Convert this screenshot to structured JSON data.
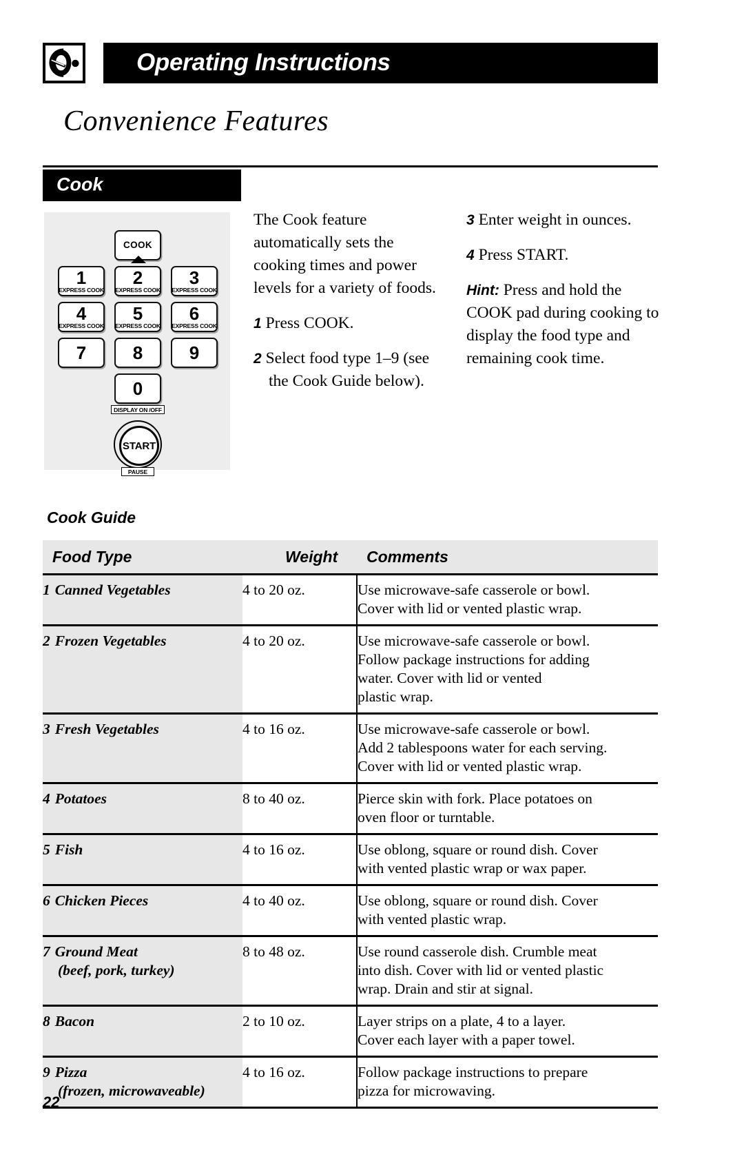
{
  "header": {
    "title": "Operating Instructions",
    "icon": "microwave-door-icon"
  },
  "chapter_title": "Convenience Features",
  "section": {
    "label": "Cook"
  },
  "control_panel": {
    "cook_key": "COOK",
    "express_cook_sub": "EXPRESS COOK",
    "keys": [
      {
        "num": "1",
        "sub": "EXPRESS COOK"
      },
      {
        "num": "2",
        "sub": "EXPRESS COOK"
      },
      {
        "num": "3",
        "sub": "EXPRESS COOK"
      },
      {
        "num": "4",
        "sub": "EXPRESS COOK"
      },
      {
        "num": "5",
        "sub": "EXPRESS COOK"
      },
      {
        "num": "6",
        "sub": "EXPRESS COOK"
      },
      {
        "num": "7",
        "sub": ""
      },
      {
        "num": "8",
        "sub": ""
      },
      {
        "num": "9",
        "sub": ""
      },
      {
        "num": "0",
        "sub": ""
      }
    ],
    "display_tag": "DISPLAY ON /OFF",
    "start_label": "START",
    "pause_label": "PAUSE"
  },
  "instructions": {
    "intro": "The Cook feature automatically sets the cooking times and power levels for a variety of foods.",
    "steps": [
      {
        "num": "1",
        "text": "Press COOK."
      },
      {
        "num": "2",
        "text": "Select food type 1–9 (see the Cook Guide below)."
      },
      {
        "num": "3",
        "text": "Enter weight in ounces."
      },
      {
        "num": "4",
        "text": "Press START."
      }
    ],
    "hint_label": "Hint:",
    "hint_text": "Press and hold the COOK pad during cooking to display the food type and remaining cook time."
  },
  "guide": {
    "title": "Cook Guide",
    "columns": [
      "Food Type",
      "Weight",
      "Comments"
    ],
    "rows": [
      {
        "num": "1",
        "food": "Canned Vegetables",
        "food_sub": "",
        "weight": "4 to 20 oz.",
        "comments": [
          "Use microwave-safe casserole or bowl.",
          "Cover with lid or vented plastic wrap."
        ]
      },
      {
        "num": "2",
        "food": "Frozen Vegetables",
        "food_sub": "",
        "weight": "4 to 20 oz.",
        "comments": [
          "Use microwave-safe casserole or bowl.",
          "Follow package instructions for adding",
          "water. Cover with lid or vented",
          "plastic wrap."
        ]
      },
      {
        "num": "3",
        "food": "Fresh Vegetables",
        "food_sub": "",
        "weight": "4 to 16 oz.",
        "comments": [
          "Use microwave-safe casserole or bowl.",
          "Add 2 tablespoons water for each serving.",
          "Cover with lid or vented plastic wrap."
        ]
      },
      {
        "num": "4",
        "food": "Potatoes",
        "food_sub": "",
        "weight": "8 to 40 oz.",
        "comments": [
          "Pierce skin with fork. Place potatoes on",
          "oven floor or turntable."
        ]
      },
      {
        "num": "5",
        "food": "Fish",
        "food_sub": "",
        "weight": "4 to 16 oz.",
        "comments": [
          "Use oblong, square or round dish. Cover",
          "with vented plastic wrap or wax paper."
        ]
      },
      {
        "num": "6",
        "food": "Chicken Pieces",
        "food_sub": "",
        "weight": "4 to 40 oz.",
        "comments": [
          "Use oblong, square or round dish. Cover",
          "with vented plastic wrap."
        ]
      },
      {
        "num": "7",
        "food": "Ground Meat",
        "food_sub": "(beef, pork, turkey)",
        "weight": "8 to 48 oz.",
        "comments": [
          "Use round casserole dish. Crumble meat",
          "into dish. Cover with lid or vented plastic",
          "wrap. Drain and stir at signal."
        ]
      },
      {
        "num": "8",
        "food": "Bacon",
        "food_sub": "",
        "weight": "2 to 10 oz.",
        "comments": [
          "Layer strips on a plate, 4 to a layer.",
          "Cover each layer with a paper towel."
        ]
      },
      {
        "num": "9",
        "food": "Pizza",
        "food_sub": "(frozen, microwaveable)",
        "weight": "4 to 16 oz.",
        "comments": [
          "Follow package instructions to prepare",
          "pizza for microwaving."
        ]
      }
    ]
  },
  "page_number": "22"
}
